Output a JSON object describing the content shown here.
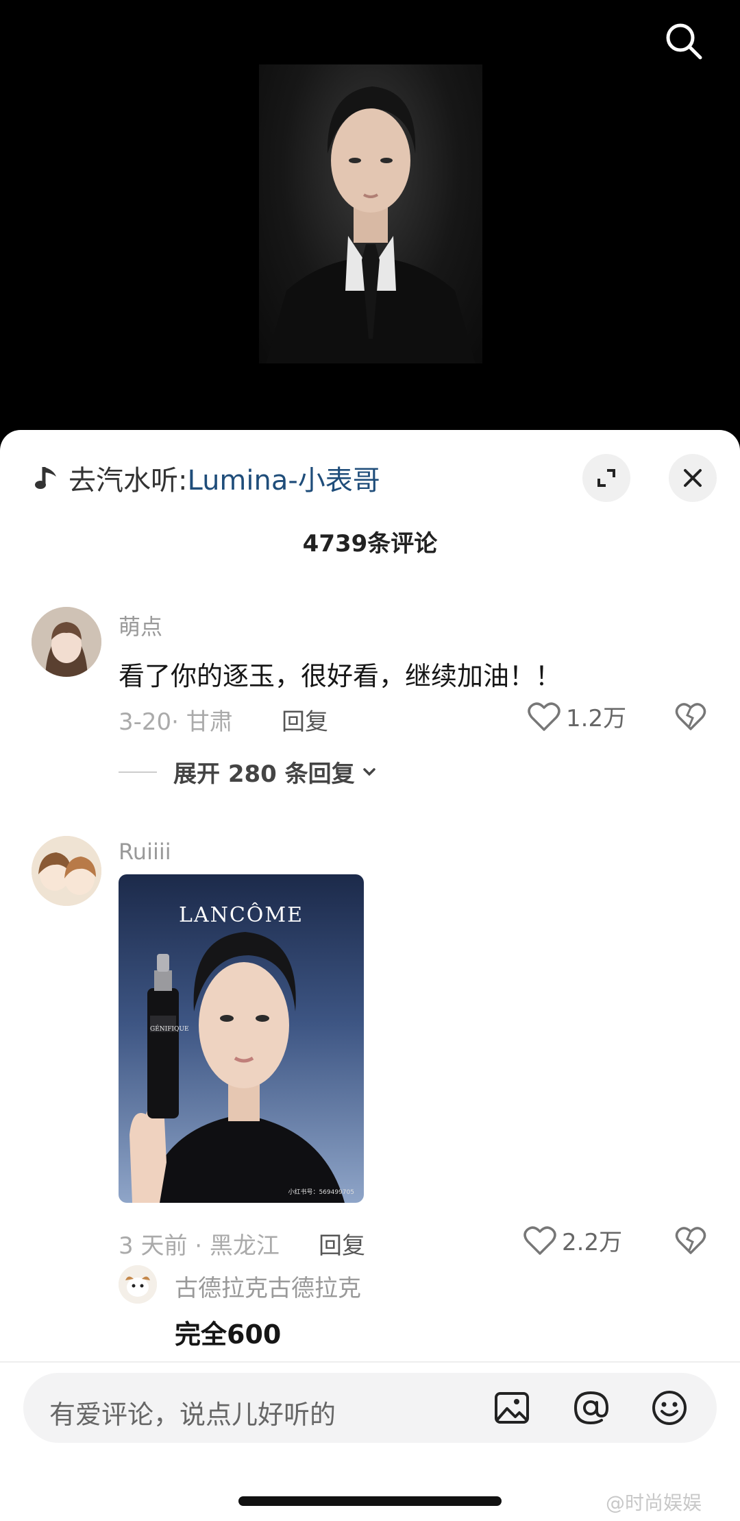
{
  "music": {
    "prefix": "去汽水听:",
    "song": "Lumina-小表哥"
  },
  "comments_header": {
    "count_text": "4739条评论"
  },
  "comments": [
    {
      "user": "萌点",
      "text": "看了你的逐玉，很好看，继续加油！！",
      "meta": "3-20· 甘肃",
      "reply_label": "回复",
      "likes": "1.2万",
      "expand_label": "展开 280 条回复"
    },
    {
      "user": "Ruiiii",
      "image_brand": "LANCÔME",
      "image_product": "GÉNIFIQUE",
      "image_watermark": "小红书号：569499705",
      "meta": "3 天前 · 黑龙江",
      "reply_label": "回复",
      "likes": "2.2万",
      "sub_reply": {
        "user": "古德拉克古德拉克",
        "text": "完全600"
      }
    }
  ],
  "input": {
    "placeholder": "有爱评论，说点儿好听的"
  },
  "watermark": "@时尚娱娱",
  "colors": {
    "song_link": "#1f4d7a",
    "sheet_bg": "#ffffff",
    "input_bg": "#f3f3f4"
  },
  "icons": [
    "search-icon",
    "music-note-icon",
    "expand-icon",
    "close-icon",
    "heart-icon",
    "broken-heart-icon",
    "chevron-down-icon",
    "image-icon",
    "at-icon",
    "emoji-icon"
  ]
}
